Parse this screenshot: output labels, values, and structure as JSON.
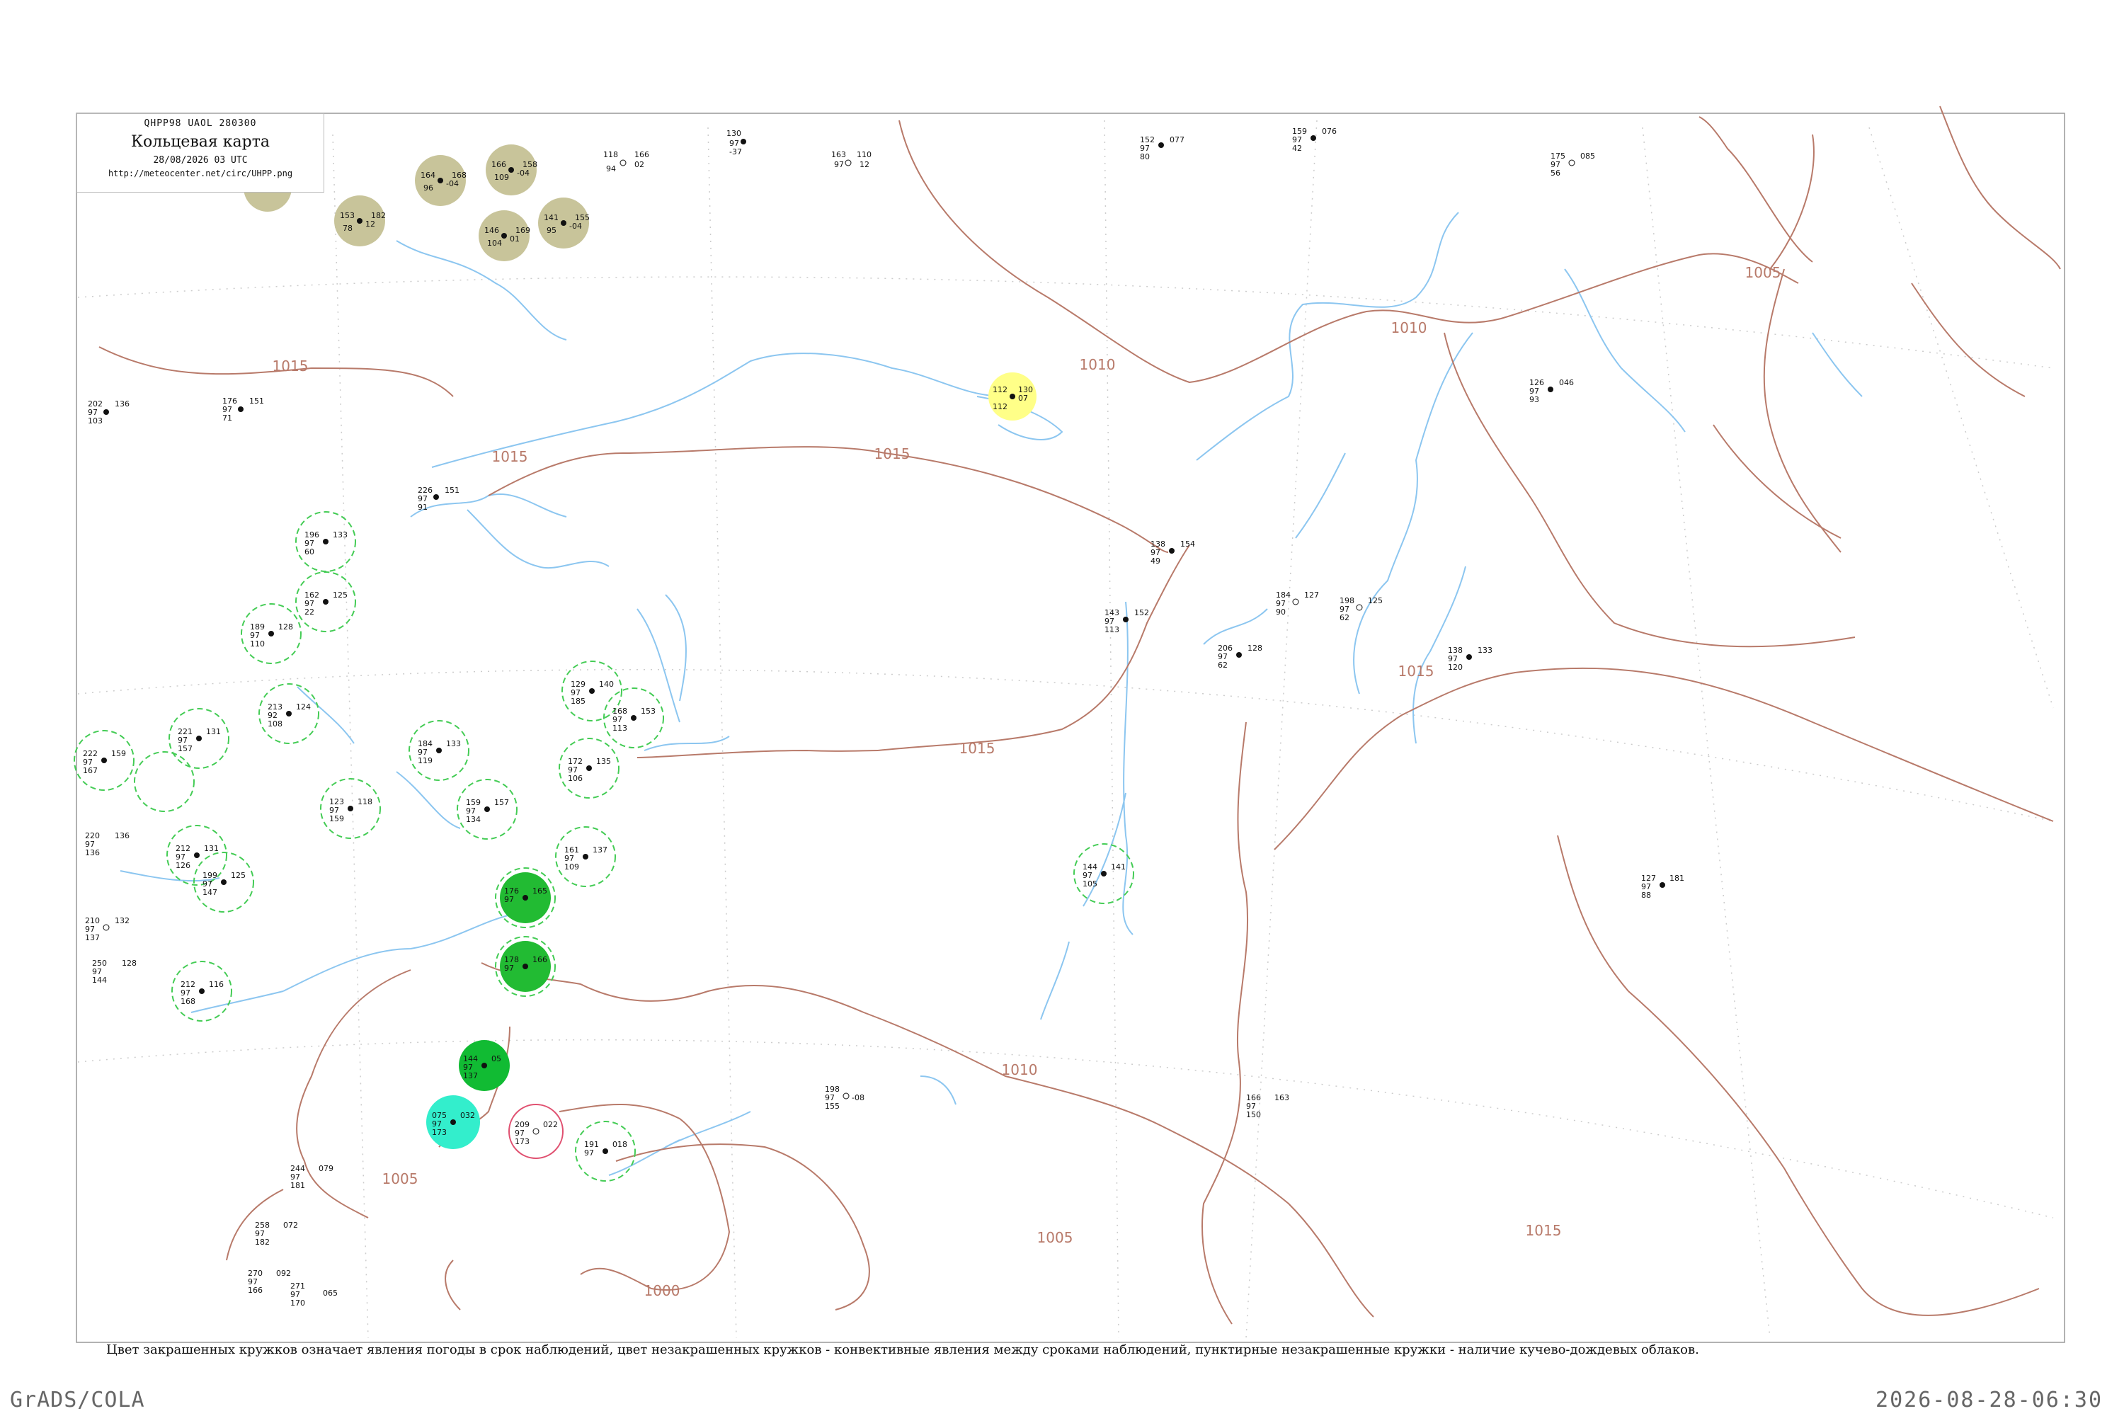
{
  "header": {
    "code": "QHPP98  UAOL  280300",
    "title": "Кольцевая карта",
    "date": "28/08/2026 03 UTC",
    "url": "http://meteocenter.net/circ/UHPP.png"
  },
  "isobar_labels": [
    "1015",
    "1015",
    "1015",
    "1015",
    "1010",
    "1010",
    "1010",
    "1015",
    "1005",
    "1000",
    "1005",
    "1005",
    "1015"
  ],
  "colors": {
    "isobar": "#b87a6a",
    "coastline": "#8cc6f0",
    "border": "#999999",
    "grid": "#cccccc",
    "fog_circle": "#c8c49a",
    "rain_circle": "#22bb33",
    "showers_dashed": "#44cc55",
    "drizzle_circle": "#ffff88",
    "snow_circle": "#33eecc",
    "thunder_ring": "#e05070",
    "station_text": "#111111",
    "station_name": "#888888"
  },
  "stations": [
    {
      "pressure": "164",
      "dev": "-04",
      "temp": "96",
      "mark": "fog",
      "label": "168"
    },
    {
      "pressure": "166",
      "dev": "-04",
      "temp": "109",
      "mark": "fog",
      "label": "158"
    },
    {
      "pressure": "153",
      "dev": "12",
      "temp": "78",
      "mark": "fog",
      "label": "182"
    },
    {
      "pressure": "141",
      "dev": "-04",
      "temp": "95",
      "mark": "fog",
      "label": "155"
    },
    {
      "pressure": "146",
      "dev": "01",
      "temp": "104",
      "mark": "fog",
      "label": "169"
    },
    {
      "pressure": "118",
      "dev": "02",
      "temp": "94",
      "mark": "none",
      "label": "166"
    },
    {
      "pressure": "130",
      "dev": "97",
      "temp": "-37",
      "mark": "none",
      "label": ""
    },
    {
      "pressure": "163",
      "dev": "97",
      "temp": "12",
      "mark": "none",
      "label": "110"
    },
    {
      "pressure": "152",
      "dev": "97",
      "temp": "80",
      "mark": "none",
      "label": "077"
    },
    {
      "pressure": "159",
      "dev": "97",
      "temp": "42",
      "mark": "none",
      "label": "076"
    },
    {
      "pressure": "175",
      "dev": "97",
      "temp": "56",
      "mark": "none",
      "label": "085"
    },
    {
      "pressure": "112",
      "dev": "07",
      "temp": "112",
      "mark": "drizzle",
      "label": "130"
    },
    {
      "pressure": "126",
      "dev": "97",
      "temp": "93",
      "mark": "none",
      "label": "046"
    },
    {
      "pressure": "202",
      "dev": "97",
      "temp": "103",
      "mark": "none",
      "label": "136"
    },
    {
      "pressure": "176",
      "dev": "97",
      "temp": "71",
      "mark": "none",
      "label": "151"
    },
    {
      "pressure": "226",
      "dev": "97",
      "temp": "91",
      "mark": "none",
      "label": "151"
    },
    {
      "pressure": "138",
      "dev": "97",
      "temp": "49",
      "mark": "none",
      "label": "154"
    },
    {
      "pressure": "184",
      "dev": "97",
      "temp": "90",
      "mark": "none",
      "label": "127"
    },
    {
      "pressure": "198",
      "dev": "97",
      "temp": "62",
      "mark": "none",
      "label": "125"
    },
    {
      "pressure": "143",
      "dev": "97",
      "temp": "113",
      "mark": "none",
      "label": "152"
    },
    {
      "pressure": "206",
      "dev": "97",
      "temp": "62",
      "mark": "none",
      "label": "128"
    },
    {
      "pressure": "138",
      "dev": "97",
      "temp": "120",
      "mark": "none",
      "label": "133"
    },
    {
      "pressure": "196",
      "dev": "97",
      "temp": "60",
      "mark": "showers",
      "label": "133"
    },
    {
      "pressure": "162",
      "dev": "97",
      "temp": "22",
      "mark": "showers",
      "label": "125"
    },
    {
      "pressure": "189",
      "dev": "97",
      "temp": "110",
      "mark": "showers",
      "label": "128"
    },
    {
      "pressure": "213",
      "dev": "92",
      "temp": "108",
      "mark": "showers",
      "label": "124"
    },
    {
      "pressure": "221",
      "dev": "97",
      "temp": "157",
      "mark": "showers",
      "label": "131"
    },
    {
      "pressure": "222",
      "dev": "97",
      "temp": "167",
      "mark": "showers",
      "label": "159"
    },
    {
      "pressure": "129",
      "dev": "97",
      "temp": "185",
      "mark": "showers",
      "label": "140"
    },
    {
      "pressure": "168",
      "dev": "97",
      "temp": "113",
      "mark": "showers",
      "label": "153"
    },
    {
      "pressure": "184",
      "dev": "97",
      "temp": "119",
      "mark": "showers",
      "label": "133"
    },
    {
      "pressure": "159",
      "dev": "97",
      "temp": "134",
      "mark": "showers",
      "label": "157"
    },
    {
      "pressure": "172",
      "dev": "97",
      "temp": "106",
      "mark": "showers",
      "label": "135"
    },
    {
      "pressure": "161",
      "dev": "97",
      "temp": "109",
      "mark": "showers",
      "label": "137"
    },
    {
      "pressure": "212",
      "dev": "97",
      "temp": "126",
      "mark": "showers",
      "label": "131"
    },
    {
      "pressure": "199",
      "dev": "97",
      "temp": "147",
      "mark": "showers",
      "label": "125"
    },
    {
      "pressure": "123",
      "dev": "97",
      "temp": "159",
      "mark": "showers",
      "label": "118"
    },
    {
      "pressure": "144",
      "dev": "97",
      "temp": "105",
      "mark": "showers",
      "label": "141"
    },
    {
      "pressure": "212",
      "dev": "97",
      "temp": "168",
      "mark": "showers",
      "label": "116"
    },
    {
      "pressure": "176",
      "dev": "97",
      "temp": "",
      "mark": "rain",
      "label": "165"
    },
    {
      "pressure": "178",
      "dev": "97",
      "temp": "",
      "mark": "rain",
      "label": "166"
    },
    {
      "pressure": "144",
      "dev": "97",
      "temp": "137",
      "mark": "rain",
      "label": "05"
    },
    {
      "pressure": "075",
      "dev": "97",
      "temp": "173",
      "mark": "snow",
      "label": "032"
    },
    {
      "pressure": "209",
      "dev": "97",
      "temp": "173",
      "mark": "thunder",
      "label": "022"
    },
    {
      "pressure": "191",
      "dev": "97",
      "temp": "",
      "mark": "showers",
      "label": "018"
    },
    {
      "pressure": "198",
      "dev": "97",
      "temp": "155",
      "mark": "none",
      "label": "-08"
    },
    {
      "pressure": "166",
      "dev": "97",
      "temp": "150",
      "mark": "none",
      "label": "163"
    },
    {
      "pressure": "127",
      "dev": "97",
      "temp": "88",
      "mark": "none",
      "label": "181"
    },
    {
      "pressure": "220",
      "dev": "97",
      "temp": "136",
      "mark": "none",
      "label": "136"
    },
    {
      "pressure": "210",
      "dev": "97",
      "temp": "137",
      "mark": "none",
      "label": "132"
    },
    {
      "pressure": "250",
      "dev": "97",
      "temp": "144",
      "mark": "none",
      "label": "128"
    },
    {
      "pressure": "244",
      "dev": "97",
      "temp": "181",
      "mark": "none",
      "label": "079"
    },
    {
      "pressure": "258",
      "dev": "97",
      "temp": "182",
      "mark": "none",
      "label": "072"
    },
    {
      "pressure": "270",
      "dev": "97",
      "temp": "166",
      "mark": "none",
      "label": "092"
    },
    {
      "pressure": "271",
      "dev": "97",
      "temp": "170",
      "mark": "none",
      "label": "065"
    }
  ],
  "caption": "Цвет закрашенных кружков означает явления погоды в срок наблюдений, цвет незакрашенных кружков - конвективные явления между сроками наблюдений, пунктирные незакрашенные кружки - наличие кучево-дождевых облаков.",
  "footer": {
    "left": "GrADS/COLA",
    "right": "2026-08-28-06:30"
  }
}
